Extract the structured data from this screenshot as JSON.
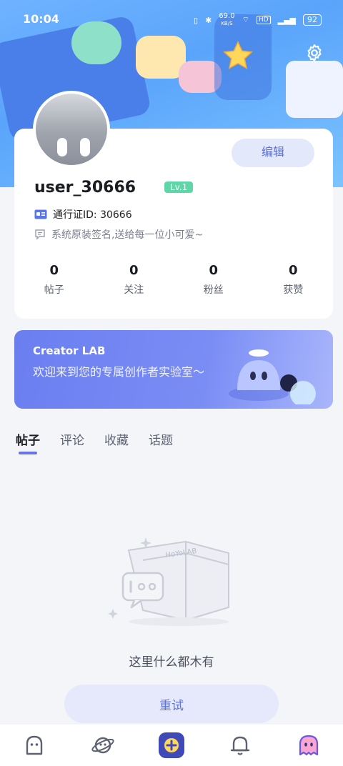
{
  "status_bar": {
    "time": "10:04",
    "net_speed": "69.0",
    "net_unit": "KB/S",
    "battery": "92"
  },
  "profile": {
    "edit_label": "编辑",
    "username": "user_30666",
    "level": "Lv.1",
    "id_label": "通行证ID: 30666",
    "signature": "系统原装签名,送给每一位小可爱~"
  },
  "stats": [
    {
      "value": "0",
      "label": "帖子"
    },
    {
      "value": "0",
      "label": "关注"
    },
    {
      "value": "0",
      "label": "粉丝"
    },
    {
      "value": "0",
      "label": "获赞"
    }
  ],
  "banner": {
    "title": "Creator LAB",
    "subtitle": "欢迎来到您的专属创作者实验室～"
  },
  "tabs": [
    {
      "label": "帖子",
      "active": true
    },
    {
      "label": "评论"
    },
    {
      "label": "收藏"
    },
    {
      "label": "话题"
    }
  ],
  "empty": {
    "box_text": "HoYoLAB",
    "message": "这里什么都木有",
    "retry_label": "重试"
  },
  "nav": [
    {
      "icon": "home-icon"
    },
    {
      "icon": "planet-icon"
    },
    {
      "icon": "create-icon"
    },
    {
      "icon": "bell-icon"
    },
    {
      "icon": "profile-ghost-icon"
    }
  ]
}
